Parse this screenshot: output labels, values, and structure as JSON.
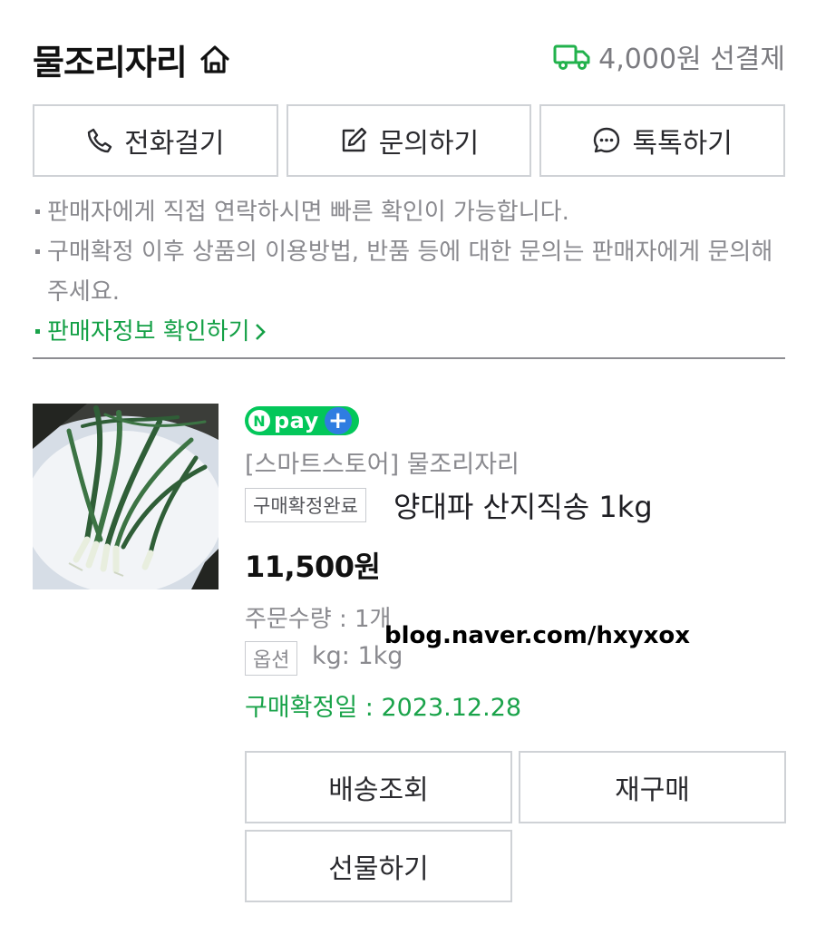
{
  "seller": {
    "name": "물조리자리",
    "icon": "home-icon"
  },
  "shipping": {
    "text": "4,000원 선결제",
    "icon": "truck-icon",
    "icon_color": "#22b24c"
  },
  "contact_buttons": [
    {
      "label": "전화걸기",
      "icon": "phone-icon"
    },
    {
      "label": "문의하기",
      "icon": "edit-icon"
    },
    {
      "label": "톡톡하기",
      "icon": "chat-icon"
    }
  ],
  "notes": [
    "판매자에게 직접 연락하시면 빠른 확인이 가능합니다.",
    "구매확정 이후 상품의 이용방법, 반품 등에 대한 문의는 판매자에게 문의해 주세요."
  ],
  "seller_info_link": "판매자정보 확인하기",
  "order": {
    "npay": {
      "n": "N",
      "text": "pay",
      "plus": "+",
      "color": "#03c75a"
    },
    "store": "[스마트스토어] 물조리자리",
    "status": "구매확정완료",
    "title": "양대파 산지직송 1kg",
    "price": "11,500원",
    "quantity": "주문수량 : 1개",
    "option_label": "옵션",
    "option_value": "kg: 1kg",
    "confirm_date": "구매확정일 : 2023.12.28",
    "watermark": "blog.naver.com/hxyxox"
  },
  "actions": {
    "track": "배송조회",
    "rebuy": "재구매",
    "gift": "선물하기"
  },
  "colors": {
    "green": "#1aa34a",
    "border": "#cfd2d6",
    "muted": "#8a8a8f"
  }
}
